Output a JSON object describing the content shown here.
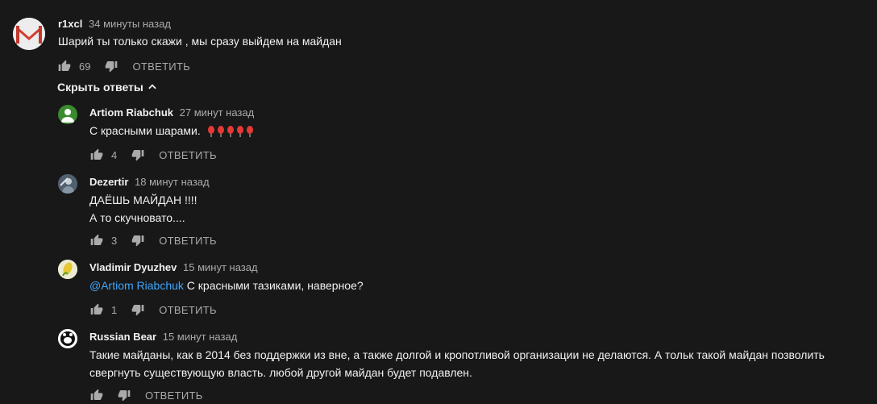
{
  "top_comment": {
    "author": "r1xcl",
    "time": "34 минуты назад",
    "text": "Шарий ты только скажи , мы сразу выйдем на майдан",
    "likes": "69",
    "reply_label": "ОТВЕТИТЬ",
    "avatar_icon": "gmail-envelope-icon"
  },
  "hide_replies_label": "Скрыть ответы",
  "replies": [
    {
      "author": "Artiom Riabchuk",
      "time": "27 минут назад",
      "text": "С красными шарами.",
      "balloons": 5,
      "likes": "4",
      "reply_label": "ОТВЕТИТЬ",
      "avatar_color": "#3a8a2e"
    },
    {
      "author": "Dezertir",
      "time": "18 минут назад",
      "line1": "ДАЁШЬ МАЙДАН !!!!",
      "line2": "А то скучновато....",
      "likes": "3",
      "reply_label": "ОТВЕТИТЬ"
    },
    {
      "author": "Vladimir Dyuzhev",
      "time": "15 минут назад",
      "mention": "@Artiom Riabchuk",
      "text": " С красными тазиками, наверное?",
      "likes": "1",
      "reply_label": "ОТВЕТИТЬ"
    },
    {
      "author": "Russian Bear",
      "time": "15 минут назад",
      "line1": "Такие майданы, как в 2014 без поддержки из вне, а также долгой и кропотливой организации не делаются. А тольк такой майдан позволить",
      "line2": "свергнуть существующую власть. любой другой майдан будет подавлен.",
      "likes": "",
      "reply_label": "ОТВЕТИТЬ"
    }
  ]
}
